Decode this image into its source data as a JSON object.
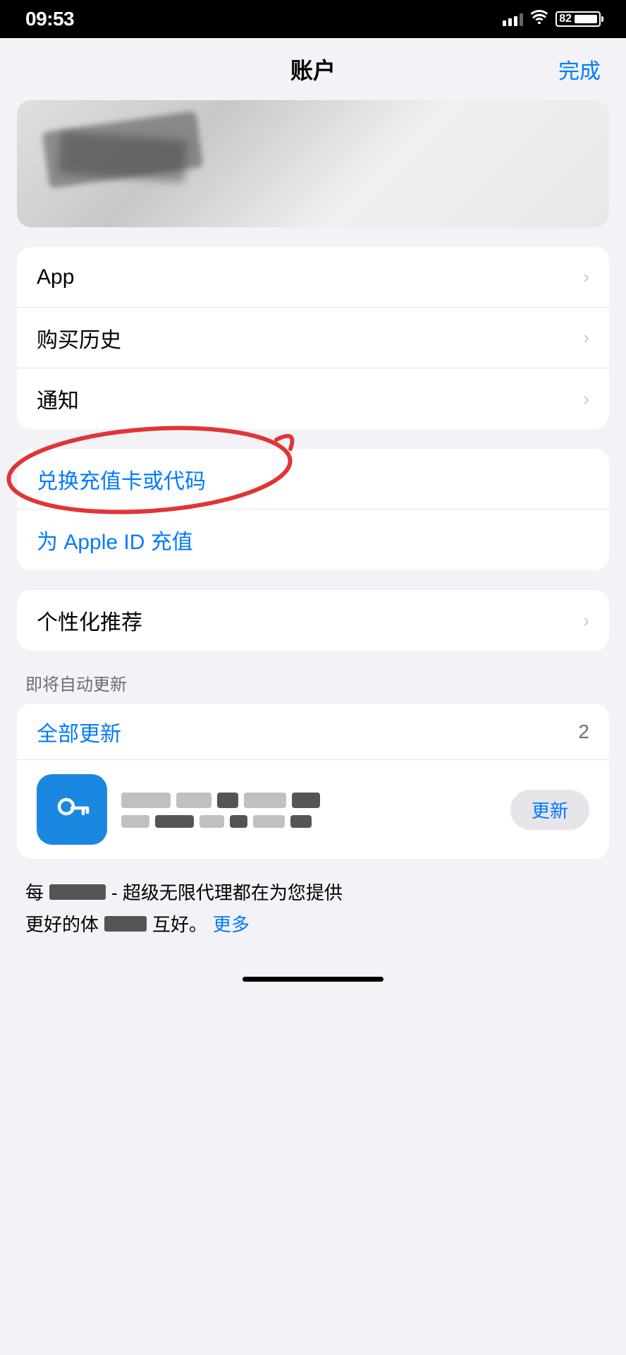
{
  "statusBar": {
    "time": "09:53",
    "batteryPercent": "82"
  },
  "navBar": {
    "title": "账户",
    "doneLabel": "完成"
  },
  "menuSection1": {
    "items": [
      {
        "label": "App",
        "hasChevron": true
      },
      {
        "label": "购买历史",
        "hasChevron": true
      },
      {
        "label": "通知",
        "hasChevron": true
      }
    ]
  },
  "redeemSection": {
    "redeemLabel": "兑换充值卡或代码",
    "topupLabel": "为 Apple ID 充值"
  },
  "personalizedSection": {
    "label": "个性化推荐",
    "hasChevron": true
  },
  "autoUpdateSection": {
    "sectionTitle": "即将自动更新",
    "allUpdatesLabel": "全部更新",
    "allUpdatesCount": "2",
    "updateButtonLabel": "更新"
  },
  "appDescription": {
    "prefix": "每",
    "suffix": "超级无限代理都在为您提供",
    "line2prefix": "更好的体",
    "line2suffix": "互好。",
    "moreLabel": "更多"
  }
}
